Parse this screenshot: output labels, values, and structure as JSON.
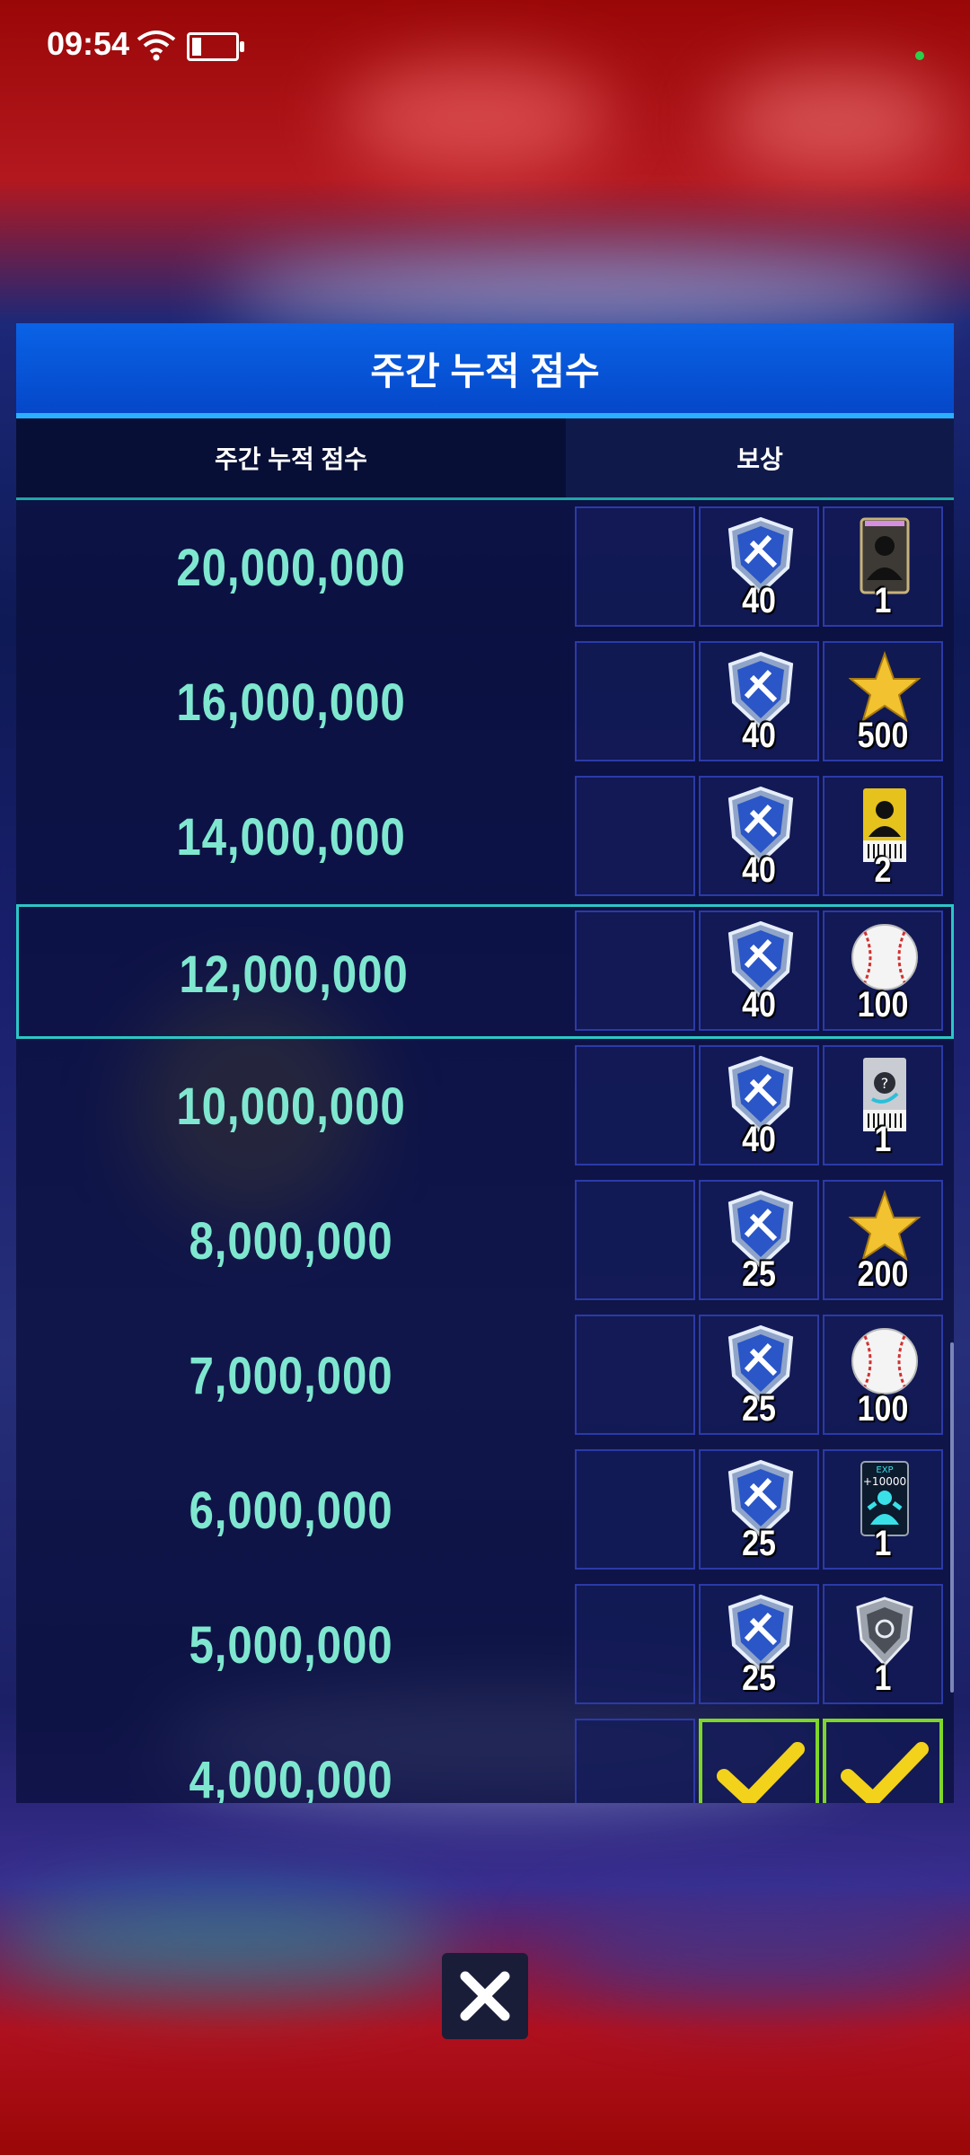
{
  "status_bar": {
    "time": "09:54"
  },
  "panel": {
    "title": "주간 누적 점수",
    "col_score": "주간 누적 점수",
    "col_reward": "보상"
  },
  "rows": [
    {
      "score": "20,000,000",
      "reward2_qty": "40",
      "reward3_icon": "player-card-icon",
      "reward3_qty": "1",
      "current": false
    },
    {
      "score": "16,000,000",
      "reward2_qty": "40",
      "reward3_icon": "gold-star-icon",
      "reward3_qty": "500",
      "current": false
    },
    {
      "score": "14,000,000",
      "reward2_qty": "40",
      "reward3_icon": "gold-player-ticket-icon",
      "reward3_qty": "2",
      "current": false
    },
    {
      "score": "12,000,000",
      "reward2_qty": "40",
      "reward3_icon": "baseball-icon",
      "reward3_qty": "100",
      "current": true
    },
    {
      "score": "10,000,000",
      "reward2_qty": "40",
      "reward3_icon": "mystery-ticket-icon",
      "reward3_qty": "1",
      "current": false
    },
    {
      "score": "8,000,000",
      "reward2_qty": "25",
      "reward3_icon": "gold-star-icon",
      "reward3_qty": "200",
      "current": false
    },
    {
      "score": "7,000,000",
      "reward2_qty": "25",
      "reward3_icon": "baseball-icon",
      "reward3_qty": "100",
      "current": false
    },
    {
      "score": "6,000,000",
      "reward2_qty": "25",
      "reward3_icon": "exp-card-icon",
      "reward3_qty": "1",
      "current": false
    },
    {
      "score": "5,000,000",
      "reward2_qty": "25",
      "reward3_icon": "silver-shield-icon",
      "reward3_qty": "1",
      "current": false
    },
    {
      "score": "4,000,000",
      "reward2_qty": "",
      "reward3_icon": "claimed-check-icon",
      "reward3_qty": "",
      "current": false
    }
  ],
  "card_texts": {
    "exp_label": "EXP",
    "exp_value": "+10000"
  },
  "icons": {
    "reward2": "shield-emblem-icon",
    "close": "close-icon"
  },
  "colors": {
    "header_blue": "#0a5be0",
    "score_text": "#7fe7cf",
    "highlight": "#2cc7c6",
    "claimed_border": "#7fd62a"
  }
}
